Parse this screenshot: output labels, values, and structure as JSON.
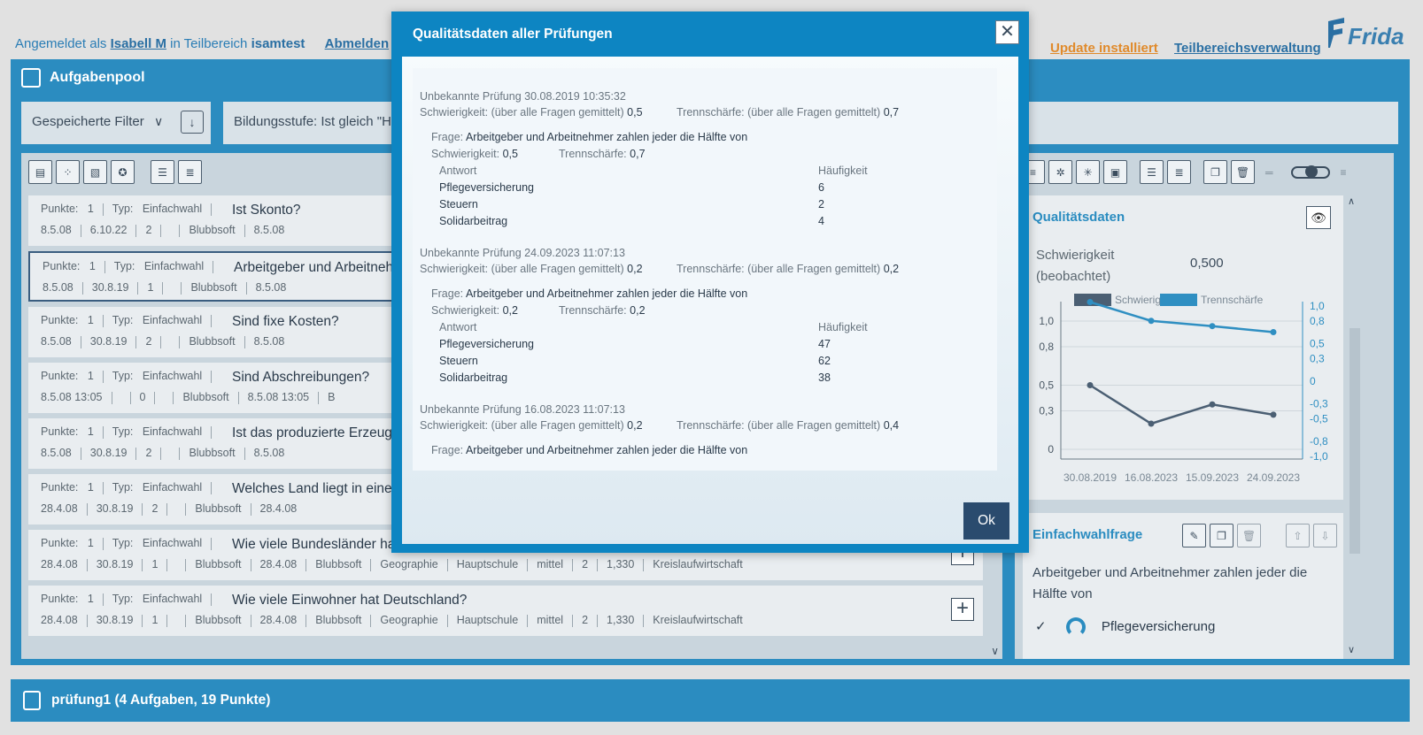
{
  "topbar": {
    "prefix": "Angemeldet als",
    "user": "Isabell M",
    "mid": "in Teilbereich",
    "area": "isamtest",
    "logout": "Abmelden",
    "update": "Update installiert",
    "admin": "Teilbereichsverwaltung",
    "logo": "Frida"
  },
  "pool": {
    "title": "Aufgabenpool",
    "saved_filter": "Gespeicherte Filter",
    "filter_text": "Bildungsstufe: Ist gleich \"H"
  },
  "rows": [
    {
      "points_label": "Punkte:",
      "points": "1",
      "type_label": "Typ:",
      "type": "Einfachwahl",
      "question": "Ist Skonto?",
      "created": "8.5.08",
      "changed": "6.10.22",
      "uses": "2",
      "author": "Blubbsoft",
      "date2": "8.5.08",
      "rest": []
    },
    {
      "points_label": "Punkte:",
      "points": "1",
      "type_label": "Typ:",
      "type": "Einfachwahl",
      "question": "Arbeitgeber und Arbeitneh",
      "created": "8.5.08",
      "changed": "30.8.19",
      "uses": "1",
      "author": "Blubbsoft",
      "date2": "8.5.08",
      "rest": []
    },
    {
      "points_label": "Punkte:",
      "points": "1",
      "type_label": "Typ:",
      "type": "Einfachwahl",
      "question": "Sind fixe Kosten?",
      "created": "8.5.08",
      "changed": "30.8.19",
      "uses": "2",
      "author": "Blubbsoft",
      "date2": "8.5.08",
      "rest": []
    },
    {
      "points_label": "Punkte:",
      "points": "1",
      "type_label": "Typ:",
      "type": "Einfachwahl",
      "question": "Sind Abschreibungen?",
      "created": "8.5.08 13:05",
      "changed": "",
      "uses": "0",
      "author": "Blubbsoft",
      "date2": "8.5.08 13:05",
      "rest": [
        "B"
      ]
    },
    {
      "points_label": "Punkte:",
      "points": "1",
      "type_label": "Typ:",
      "type": "Einfachwahl",
      "question": "Ist das produzierte Erzeug",
      "created": "8.5.08",
      "changed": "30.8.19",
      "uses": "2",
      "author": "Blubbsoft",
      "date2": "8.5.08",
      "rest": []
    },
    {
      "points_label": "Punkte:",
      "points": "1",
      "type_label": "Typ:",
      "type": "Einfachwahl",
      "question": "Welches Land liegt in eine",
      "created": "28.4.08",
      "changed": "30.8.19",
      "uses": "2",
      "author": "Blubbsoft",
      "date2": "28.4.08",
      "rest": []
    },
    {
      "points_label": "Punkte:",
      "points": "1",
      "type_label": "Typ:",
      "type": "Einfachwahl",
      "question": "Wie viele Bundesländer hat Deutschland?",
      "created": "28.4.08",
      "changed": "30.8.19",
      "uses": "1",
      "author": "Blubbsoft",
      "date2": "28.4.08",
      "rest": [
        "Blubbsoft",
        "Geographie",
        "Hauptschule",
        "mittel",
        "2",
        "1,330",
        "Kreislaufwirtschaft"
      ]
    },
    {
      "points_label": "Punkte:",
      "points": "1",
      "type_label": "Typ:",
      "type": "Einfachwahl",
      "question": "Wie viele Einwohner hat Deutschland?",
      "created": "28.4.08",
      "changed": "30.8.19",
      "uses": "1",
      "author": "Blubbsoft",
      "date2": "28.4.08",
      "rest": [
        "Blubbsoft",
        "Geographie",
        "Hauptschule",
        "mittel",
        "2",
        "1,330",
        "Kreislaufwirtschaft"
      ]
    }
  ],
  "quality": {
    "title": "Qualitätsdaten",
    "label_line1": "Schwierigkeit",
    "label_line2": "(beobachtet)",
    "value": "0,500"
  },
  "chart_data": {
    "type": "line",
    "categories": [
      "30.08.2019",
      "16.08.2023",
      "15.09.2023",
      "24.09.2023"
    ],
    "series": [
      {
        "name": "Schwierigkeit",
        "values": [
          0.5,
          0.2,
          0.35,
          0.27
        ],
        "axis": "left",
        "color": "#4b5f73"
      },
      {
        "name": "Trennschärfe",
        "values": [
          0.7,
          0.45,
          0.38,
          0.3
        ],
        "axis": "right",
        "color": "#2f8fc2"
      }
    ],
    "left_ticks": [
      "1,0",
      "0,8",
      "0,5",
      "0,3",
      "0"
    ],
    "right_ticks": [
      "1,0",
      "0,8",
      "0,5",
      "0,3",
      "0",
      "-0,3",
      "-0,5",
      "-0,8",
      "-1,0"
    ],
    "ylim_left": [
      0,
      1
    ],
    "ylim_right": [
      -1,
      1
    ],
    "grid": true,
    "legend": "top"
  },
  "single_choice": {
    "title": "Einfachwahlfrage",
    "question": "Arbeitgeber und Arbeitnehmer zahlen jeder die Hälfte von",
    "first_answer": "Pflegeversicherung",
    "check": "✓"
  },
  "bottom": {
    "label": "prüfung1 (4 Aufgaben, 19 Punkte)"
  },
  "modal": {
    "title": "Qualitätsdaten aller Prüfungen",
    "ok": "Ok",
    "difficulty_label": "Schwierigkeit: (über alle Fragen gemittelt)",
    "disc_label": "Trennschärfe: (über alle Fragen gemittelt)",
    "q_label": "Frage:",
    "q_difficulty": "Schwierigkeit:",
    "q_disc": "Trennschärfe:",
    "answer_header": "Antwort",
    "freq_header": "Häufigkeit",
    "exams": [
      {
        "name": "Unbekannte Prüfung 30.08.2019 10:35:32",
        "difficulty": "0,5",
        "disc": "0,7",
        "question": "Arbeitgeber und Arbeitnehmer zahlen jeder die Hälfte von",
        "q_difficulty": "0,5",
        "q_disc": "0,7",
        "answers": [
          {
            "a": "Pflegeversicherung",
            "f": "6"
          },
          {
            "a": "Steuern",
            "f": "2"
          },
          {
            "a": "Solidarbeitrag",
            "f": "4"
          }
        ]
      },
      {
        "name": "Unbekannte Prüfung 24.09.2023 11:07:13",
        "difficulty": "0,2",
        "disc": "0,2",
        "question": "Arbeitgeber und Arbeitnehmer zahlen jeder die Hälfte von",
        "q_difficulty": "0,2",
        "q_disc": "0,2",
        "answers": [
          {
            "a": "Pflegeversicherung",
            "f": "47"
          },
          {
            "a": "Steuern",
            "f": "62"
          },
          {
            "a": "Solidarbeitrag",
            "f": "38"
          }
        ]
      },
      {
        "name": "Unbekannte Prüfung 16.08.2023 11:07:13",
        "difficulty": "0,2",
        "disc": "0,4",
        "question": "Arbeitgeber und Arbeitnehmer zahlen jeder die Hälfte von"
      }
    ]
  }
}
